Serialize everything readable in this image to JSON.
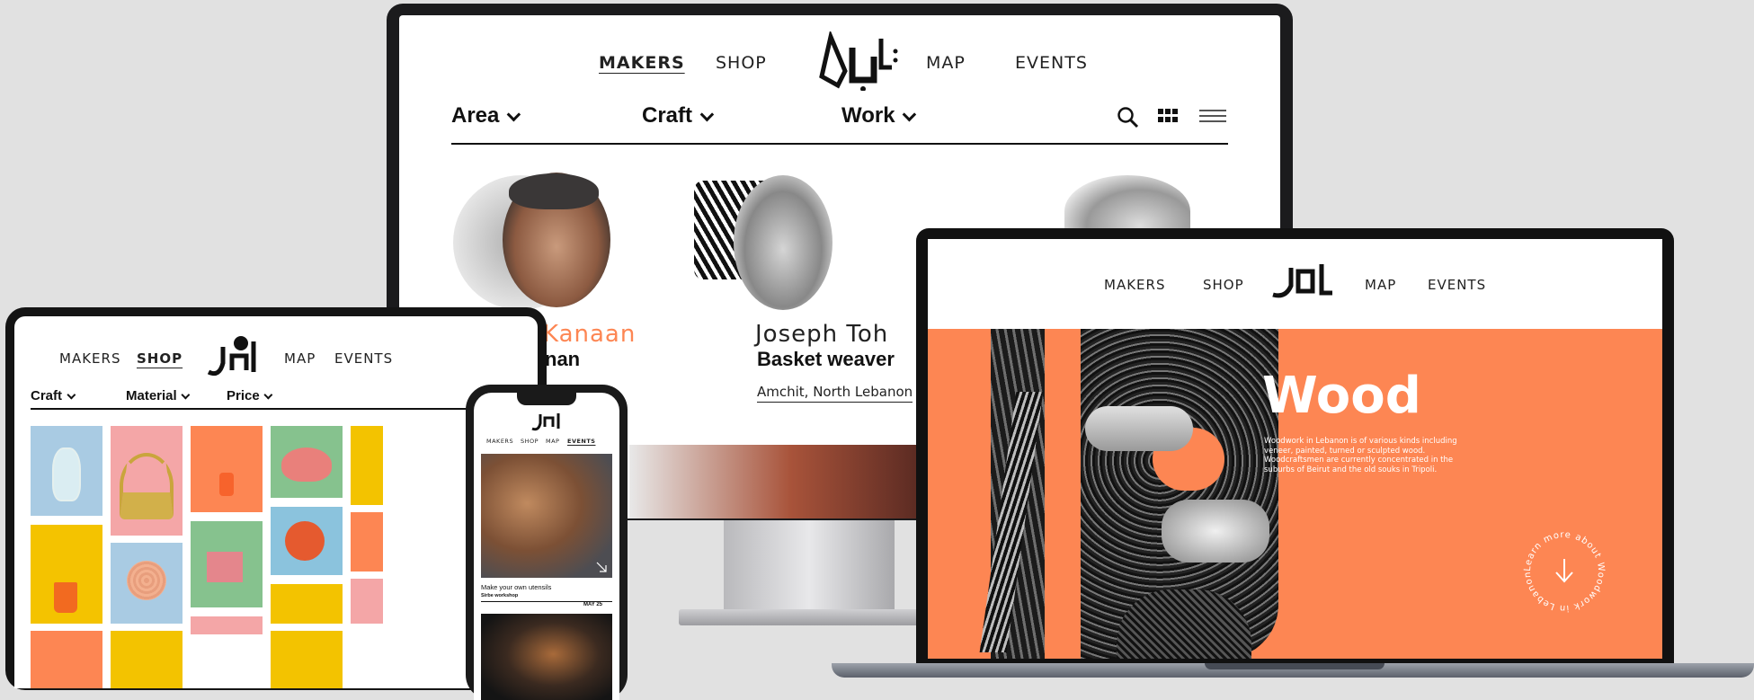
{
  "colors": {
    "accent_orange": "#fd8653",
    "ink": "#111111",
    "background": "#e1e1e1"
  },
  "monitor": {
    "nav": {
      "makers": "MAKERS",
      "shop": "SHOP",
      "map": "MAP",
      "events": "EVENTS",
      "active": "MAKERS"
    },
    "filters": [
      "Area",
      "Craft",
      "Work"
    ],
    "toolbar_icons": [
      "search-icon",
      "grid-view-icon",
      "list-view-icon"
    ],
    "makers": [
      {
        "name_visible": "Kanaan",
        "role_visible": "nan"
      },
      {
        "name_visible": "Joseph Toh",
        "role_visible": "Basket weaver",
        "location": "Amchit, North Lebanon"
      }
    ]
  },
  "laptop": {
    "nav": {
      "makers": "MAKERS",
      "shop": "SHOP",
      "map": "MAP",
      "events": "EVENTS"
    },
    "hero": {
      "title": "Wood",
      "body": "Woodwork in Lebanon is of various kinds including veneer, painted, turned or sculpted wood. Woodcraftsmen are currently concentrated in the suburbs of Beirut and the old souks in Tripoli.",
      "cta_circle_text": "Learn more about Woodwork in Lebanon",
      "cta_icon": "arrow-down-icon"
    }
  },
  "tablet": {
    "nav": {
      "makers": "MAKERS",
      "shop": "SHOP",
      "map": "MAP",
      "events": "EVENTS",
      "active": "SHOP"
    },
    "filters": [
      "Craft",
      "Material",
      "Price"
    ]
  },
  "phone": {
    "nav": {
      "makers": "MAKERS",
      "shop": "SHOP",
      "map": "MAP",
      "events": "EVENTS",
      "active": "EVENTS"
    },
    "event": {
      "title": "Make your own utensils",
      "subtitle": "Sirbe workshop",
      "date": "MAY 25"
    }
  }
}
